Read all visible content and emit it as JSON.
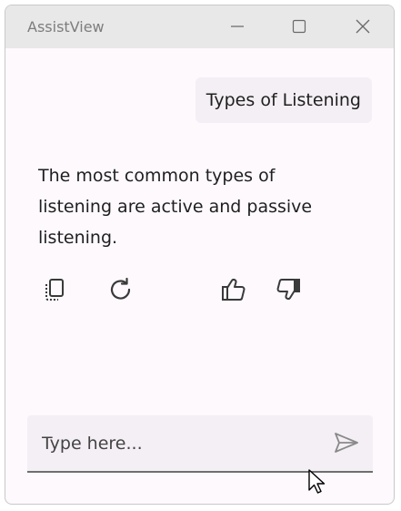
{
  "window": {
    "title": "AssistView"
  },
  "chat": {
    "user_message": "Types of Listening",
    "response_text": "The most common types of listening are active and passive listening."
  },
  "actions": {
    "icons": [
      "copy-icon",
      "regenerate-icon",
      "thumbs-up-icon",
      "thumbs-down-icon"
    ]
  },
  "input": {
    "placeholder": "Type here...",
    "value": ""
  },
  "colors": {
    "titlebar": "#e8e8e8",
    "background": "#fdf9fd",
    "bubble": "#f4eff4",
    "icon": "#3a3a3a"
  }
}
